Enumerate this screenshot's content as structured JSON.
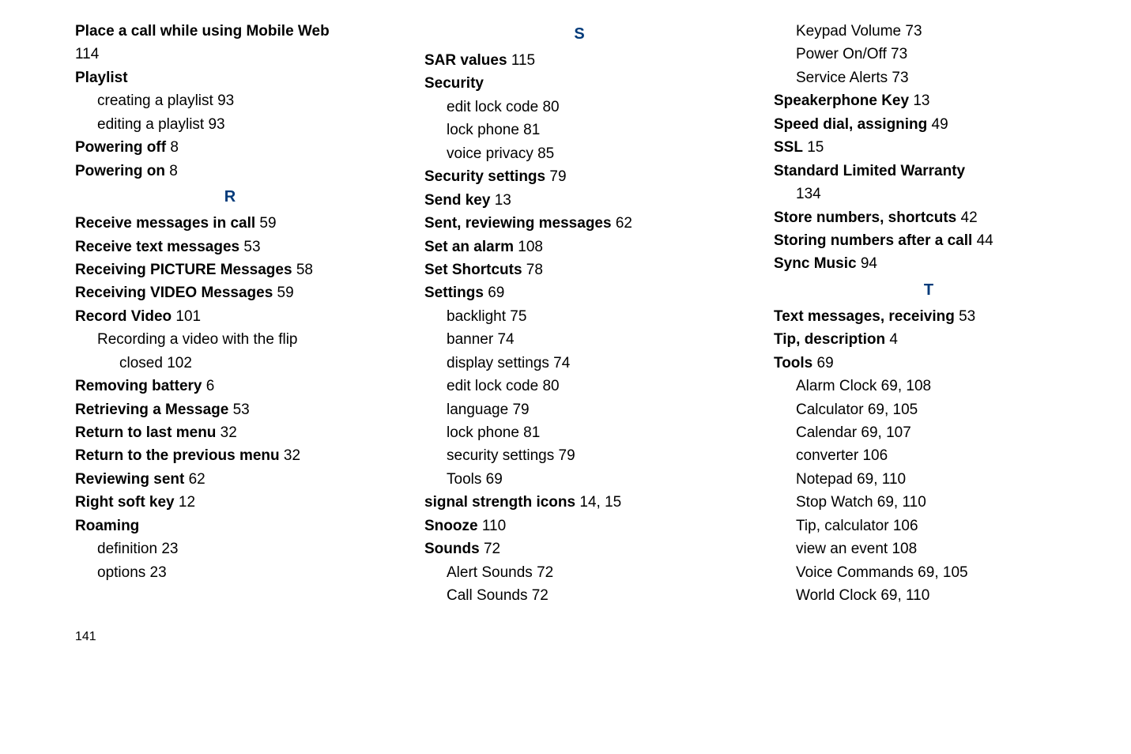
{
  "page_number": "141",
  "columns": [
    {
      "entries": [
        {
          "cls": "entry",
          "bold_text": "Place a call while using Mobile Web",
          "text": ""
        },
        {
          "cls": "entry",
          "bold_text": "",
          "text": "114"
        },
        {
          "cls": "entry",
          "bold_text": "Playlist",
          "text": ""
        },
        {
          "cls": "sub1",
          "bold_text": "",
          "text": "creating a playlist 93"
        },
        {
          "cls": "sub1",
          "bold_text": "",
          "text": "editing a playlist 93"
        },
        {
          "cls": "entry",
          "bold_text": "Powering off",
          "text": " 8"
        },
        {
          "cls": "entry",
          "bold_text": "Powering on",
          "text": " 8"
        },
        {
          "cls": "letter",
          "text": "R"
        },
        {
          "cls": "entry",
          "bold_text": "Receive messages in call",
          "text": " 59"
        },
        {
          "cls": "entry",
          "bold_text": "Receive text messages",
          "text": " 53"
        },
        {
          "cls": "entry",
          "bold_text": "Receiving PICTURE Messages",
          "text": " 58"
        },
        {
          "cls": "entry",
          "bold_text": "Receiving VIDEO Messages",
          "text": " 59"
        },
        {
          "cls": "entry",
          "bold_text": "Record Video",
          "text": " 101"
        },
        {
          "cls": "sub1",
          "bold_text": "",
          "text": "Recording a video with the flip"
        },
        {
          "cls": "sub2",
          "bold_text": "",
          "text": "closed 102"
        },
        {
          "cls": "entry",
          "bold_text": "Removing battery",
          "text": " 6"
        },
        {
          "cls": "entry",
          "bold_text": "Retrieving a Message",
          "text": " 53"
        },
        {
          "cls": "entry",
          "bold_text": "Return to last menu",
          "text": " 32"
        },
        {
          "cls": "entry",
          "bold_text": "Return to the previous menu",
          "text": " 32"
        },
        {
          "cls": "entry",
          "bold_text": "Reviewing sent",
          "text": " 62"
        },
        {
          "cls": "entry",
          "bold_text": "Right soft key",
          "text": " 12"
        },
        {
          "cls": "entry",
          "bold_text": "Roaming",
          "text": ""
        },
        {
          "cls": "sub1",
          "bold_text": "",
          "text": "definition 23"
        },
        {
          "cls": "sub1",
          "bold_text": "",
          "text": "options 23"
        }
      ]
    },
    {
      "entries": [
        {
          "cls": "letter",
          "text": "S"
        },
        {
          "cls": "entry",
          "bold_text": "SAR values",
          "text": " 115"
        },
        {
          "cls": "entry",
          "bold_text": "Security",
          "text": ""
        },
        {
          "cls": "sub1",
          "bold_text": "",
          "text": "edit lock code 80"
        },
        {
          "cls": "sub1",
          "bold_text": "",
          "text": "lock phone 81"
        },
        {
          "cls": "sub1",
          "bold_text": "",
          "text": "voice privacy 85"
        },
        {
          "cls": "entry",
          "bold_text": "Security settings",
          "text": " 79"
        },
        {
          "cls": "entry",
          "bold_text": "Send key",
          "text": " 13"
        },
        {
          "cls": "entry",
          "bold_text": "Sent, reviewing messages",
          "text": " 62"
        },
        {
          "cls": "entry",
          "bold_text": "Set an alarm",
          "text": " 108"
        },
        {
          "cls": "entry",
          "bold_text": "Set Shortcuts",
          "text": " 78"
        },
        {
          "cls": "entry",
          "bold_text": "Settings",
          "text": " 69"
        },
        {
          "cls": "sub1",
          "bold_text": "",
          "text": "backlight 75"
        },
        {
          "cls": "sub1",
          "bold_text": "",
          "text": "banner 74"
        },
        {
          "cls": "sub1",
          "bold_text": "",
          "text": "display settings 74"
        },
        {
          "cls": "sub1",
          "bold_text": "",
          "text": "edit lock code 80"
        },
        {
          "cls": "sub1",
          "bold_text": "",
          "text": "language 79"
        },
        {
          "cls": "sub1",
          "bold_text": "",
          "text": "lock phone 81"
        },
        {
          "cls": "sub1",
          "bold_text": "",
          "text": "security settings 79"
        },
        {
          "cls": "sub1",
          "bold_text": "",
          "text": "Tools 69"
        },
        {
          "cls": "entry",
          "bold_text": "signal strength icons",
          "text": " 14, 15"
        },
        {
          "cls": "entry",
          "bold_text": "Snooze",
          "text": " 110"
        },
        {
          "cls": "entry",
          "bold_text": "Sounds",
          "text": " 72"
        },
        {
          "cls": "sub1",
          "bold_text": "",
          "text": "Alert Sounds 72"
        },
        {
          "cls": "sub1",
          "bold_text": "",
          "text": "Call Sounds 72"
        }
      ]
    },
    {
      "entries": [
        {
          "cls": "sub1",
          "bold_text": "",
          "text": "Keypad Volume 73"
        },
        {
          "cls": "sub1",
          "bold_text": "",
          "text": "Power On/Off 73"
        },
        {
          "cls": "sub1",
          "bold_text": "",
          "text": "Service Alerts 73"
        },
        {
          "cls": "entry",
          "bold_text": "Speakerphone Key",
          "text": " 13"
        },
        {
          "cls": "entry",
          "bold_text": "Speed dial, assigning",
          "text": " 49"
        },
        {
          "cls": "entry",
          "bold_text": "SSL",
          "text": " 15"
        },
        {
          "cls": "entry",
          "bold_text": "Standard Limited Warranty",
          "text": ""
        },
        {
          "cls": "sub1",
          "bold_text": "",
          "text": "134"
        },
        {
          "cls": "entry",
          "bold_text": "Store numbers, shortcuts",
          "text": " 42"
        },
        {
          "cls": "entry",
          "bold_text": "Storing numbers after a call",
          "text": " 44"
        },
        {
          "cls": "entry",
          "bold_text": "Sync Music",
          "text": " 94"
        },
        {
          "cls": "letter",
          "text": "T"
        },
        {
          "cls": "entry",
          "bold_text": "Text messages, receiving",
          "text": " 53"
        },
        {
          "cls": "entry",
          "bold_text": "Tip, description",
          "text": " 4"
        },
        {
          "cls": "entry",
          "bold_text": "Tools",
          "text": " 69"
        },
        {
          "cls": "sub1",
          "bold_text": "",
          "text": "Alarm Clock 69, 108"
        },
        {
          "cls": "sub1",
          "bold_text": "",
          "text": "Calculator 69, 105"
        },
        {
          "cls": "sub1",
          "bold_text": "",
          "text": "Calendar 69, 107"
        },
        {
          "cls": "sub1",
          "bold_text": "",
          "text": "converter 106"
        },
        {
          "cls": "sub1",
          "bold_text": "",
          "text": "Notepad 69, 110"
        },
        {
          "cls": "sub1",
          "bold_text": "",
          "text": "Stop Watch 69, 110"
        },
        {
          "cls": "sub1",
          "bold_text": "",
          "text": "Tip, calculator 106"
        },
        {
          "cls": "sub1",
          "bold_text": "",
          "text": "view an event 108"
        },
        {
          "cls": "sub1",
          "bold_text": "",
          "text": "Voice Commands 69, 105"
        },
        {
          "cls": "sub1",
          "bold_text": "",
          "text": "World Clock 69, 110"
        }
      ]
    }
  ]
}
